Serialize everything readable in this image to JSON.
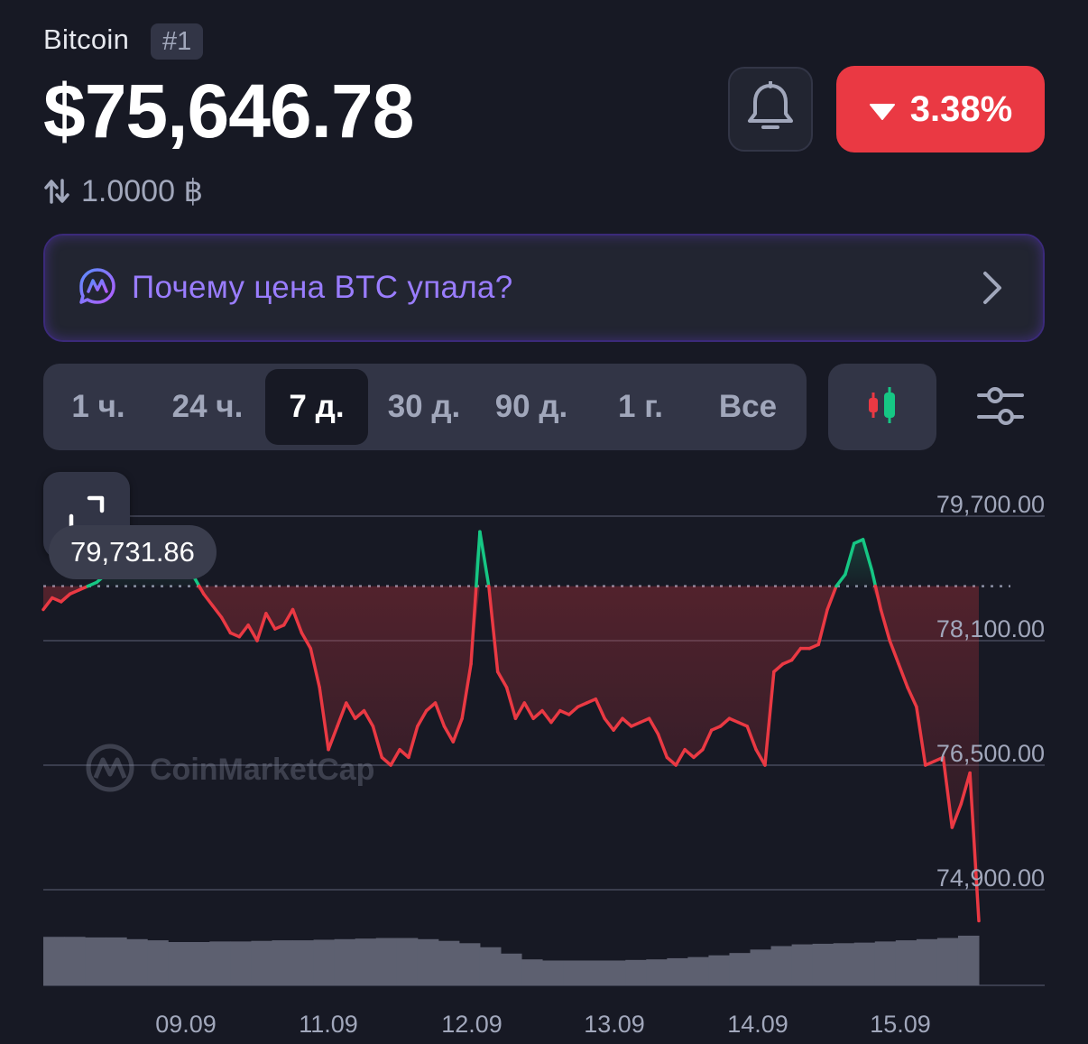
{
  "header": {
    "coin_name": "Bitcoin",
    "rank": "#1",
    "price": "$75,646.78",
    "btc_amount": "1.0000 ฿",
    "change_percent": "3.38%",
    "change_direction": "down"
  },
  "icons": {
    "swap": "swap-arrows-icon",
    "bell": "bell-icon",
    "ai": "cmc-ai-icon",
    "chevron": "chevron-right-icon",
    "candles": "candlestick-icon",
    "settings": "sliders-icon",
    "expand": "expand-icon"
  },
  "ai_banner": {
    "text": "Почему цена BTC упала?"
  },
  "period_tabs": [
    {
      "label": "1 ч.",
      "active": false
    },
    {
      "label": "24 ч.",
      "active": false
    },
    {
      "label": "7 д.",
      "active": true
    },
    {
      "label": "30 д.",
      "active": false
    },
    {
      "label": "90 д.",
      "active": false
    },
    {
      "label": "1 г.",
      "active": false
    },
    {
      "label": "Все",
      "active": false
    }
  ],
  "chart": {
    "high_label": "79,731.86",
    "watermark": "CoinMarketCap"
  },
  "colors": {
    "background": "#171924",
    "up": "#16c784",
    "down": "#ea3943",
    "ai_purple": "#9a7dff",
    "muted": "#a1a7bb"
  },
  "chart_data": {
    "type": "line",
    "title": "",
    "xlabel": "",
    "ylabel": "",
    "baseline": 78800,
    "ylim": [
      74500,
      80300
    ],
    "y_ticks": [
      79700,
      78100,
      76500,
      74900
    ],
    "y_tick_labels": [
      "79,700.00",
      "78,100.00",
      "76,500.00",
      "74,900.00"
    ],
    "x_tick_labels": [
      "09.09",
      "11.09",
      "12.09",
      "13.09",
      "14.09",
      "15.09"
    ],
    "grid": true,
    "series": [
      {
        "values": [
          78500,
          78650,
          78600,
          78700,
          78750,
          78800,
          78850,
          78950,
          79050,
          79200,
          79150,
          79300,
          79200,
          79500,
          79300,
          79400,
          79100,
          78900,
          78700,
          78550,
          78400,
          78200,
          78150,
          78300,
          78100,
          78450,
          78250,
          78300,
          78500,
          78200,
          78000,
          77500,
          76700,
          77000,
          77300,
          77100,
          77200,
          77000,
          76600,
          76500,
          76700,
          76600,
          77000,
          77200,
          77300,
          77000,
          76800,
          77100,
          77800,
          79500,
          78800,
          77700,
          77500,
          77100,
          77300,
          77100,
          77200,
          77050,
          77200,
          77150,
          77250,
          77300,
          77350,
          77100,
          76950,
          77100,
          77000,
          77050,
          77100,
          76900,
          76600,
          76500,
          76700,
          76600,
          76700,
          76950,
          77000,
          77100,
          77050,
          77000,
          76700,
          76500,
          77700,
          77800,
          77850,
          78000,
          78000,
          78050,
          78500,
          78800,
          78950,
          79350,
          79400,
          79000,
          78500,
          78100,
          77800,
          77500,
          77250,
          76500,
          76550,
          76600,
          75700,
          76000,
          76400,
          74500
        ]
      }
    ],
    "volume": [
      0.84,
      0.84,
      0.83,
      0.83,
      0.8,
      0.78,
      0.75,
      0.75,
      0.76,
      0.76,
      0.77,
      0.78,
      0.78,
      0.79,
      0.8,
      0.81,
      0.82,
      0.82,
      0.8,
      0.77,
      0.73,
      0.66,
      0.55,
      0.45,
      0.43,
      0.43,
      0.43,
      0.43,
      0.44,
      0.45,
      0.47,
      0.49,
      0.52,
      0.56,
      0.62,
      0.68,
      0.71,
      0.72,
      0.73,
      0.74,
      0.76,
      0.78,
      0.8,
      0.82,
      0.86
    ]
  }
}
